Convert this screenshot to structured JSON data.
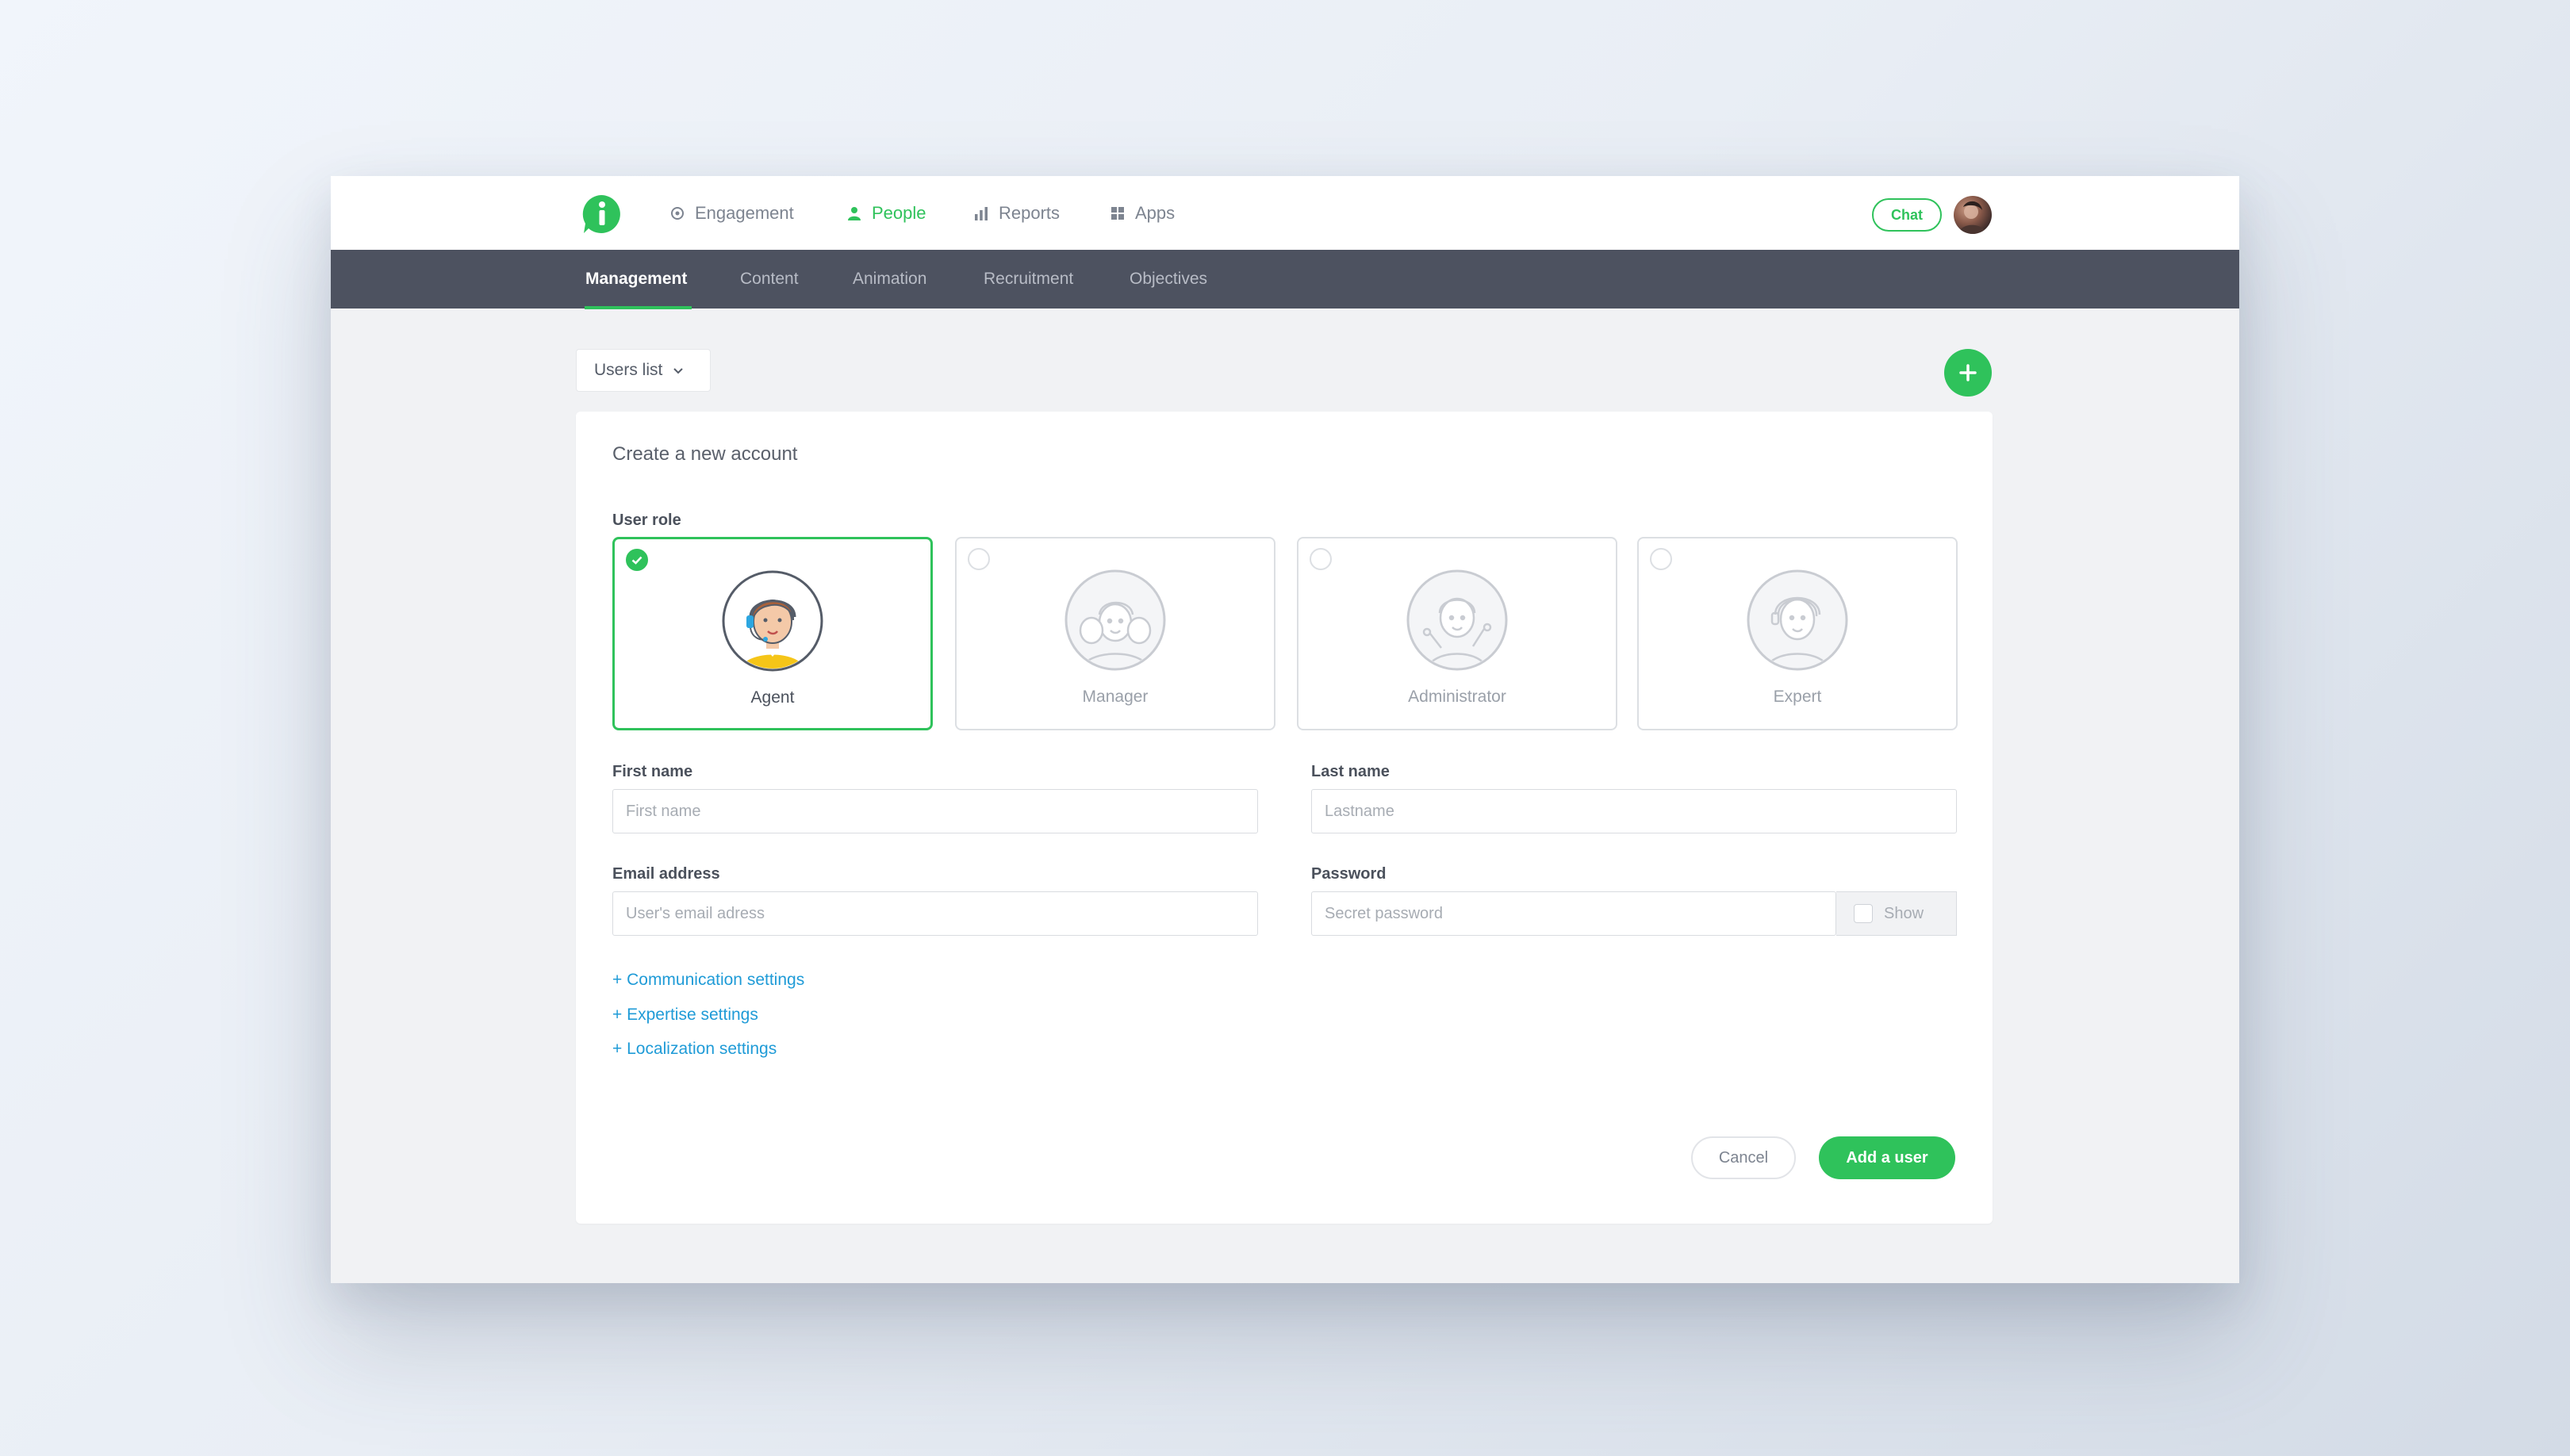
{
  "nav": {
    "items": [
      {
        "label": "Engagement",
        "icon": "target-icon"
      },
      {
        "label": "People",
        "icon": "person-icon",
        "active": true
      },
      {
        "label": "Reports",
        "icon": "bar-chart-icon"
      },
      {
        "label": "Apps",
        "icon": "grid-icon"
      }
    ],
    "chat_label": "Chat"
  },
  "subnav": {
    "items": [
      {
        "label": "Management",
        "active": true
      },
      {
        "label": "Content"
      },
      {
        "label": "Animation"
      },
      {
        "label": "Recruitment"
      },
      {
        "label": "Objectives"
      }
    ]
  },
  "toolbar": {
    "users_list_label": "Users list"
  },
  "form": {
    "title": "Create a new account",
    "user_role_label": "User role",
    "roles": [
      {
        "name": "Agent",
        "selected": true
      },
      {
        "name": "Manager",
        "selected": false
      },
      {
        "name": "Administrator",
        "selected": false
      },
      {
        "name": "Expert",
        "selected": false
      }
    ],
    "first_name": {
      "label": "First name",
      "placeholder": "First name",
      "value": ""
    },
    "last_name": {
      "label": "Last name",
      "placeholder": "Lastname",
      "value": ""
    },
    "email": {
      "label": "Email address",
      "placeholder": "User's email adress",
      "value": ""
    },
    "password": {
      "label": "Password",
      "placeholder": "Secret password",
      "value": "",
      "show_label": "Show"
    },
    "links": [
      "+ Communication settings",
      "+ Expertise settings",
      "+ Localization settings"
    ],
    "cancel_label": "Cancel",
    "submit_label": "Add a user"
  },
  "colors": {
    "accent": "#2fc25b",
    "subnav_bg": "#4d5260",
    "link": "#1f9bd7"
  }
}
